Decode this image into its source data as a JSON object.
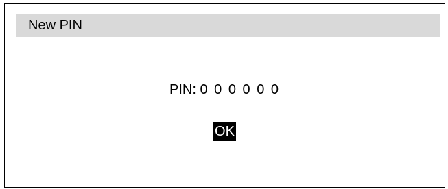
{
  "dialog": {
    "title": "New PIN",
    "pin_label": "PIN:",
    "pin_value": "0 0 0 0 0 0",
    "ok_label": "OK"
  },
  "colors": {
    "title_bar_bg": "#d9d9d9",
    "ok_button_bg": "#000000",
    "ok_button_text": "#ffffff"
  }
}
